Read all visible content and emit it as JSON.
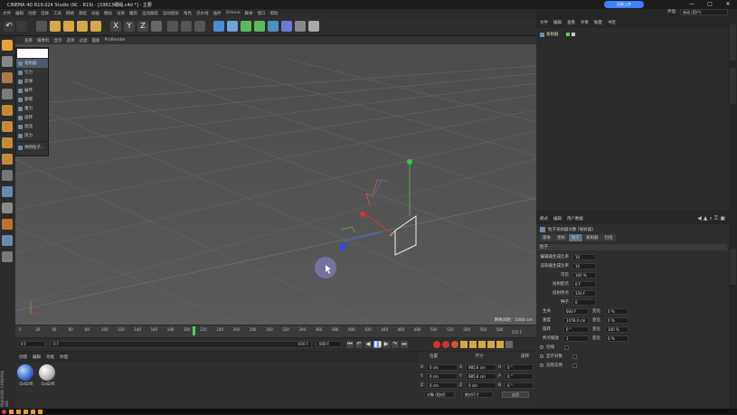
{
  "window": {
    "title": "CINEMA 4D R19.024 Studio (RC - R19) - [19613细绳.c4d *] - 主要",
    "min": "—",
    "max": "□",
    "close": "✕",
    "cloud_label": "回收上传"
  },
  "menubar": [
    "文件",
    "编辑",
    "创建",
    "选择",
    "工具",
    "网格",
    "捕捉",
    "动画",
    "模拟",
    "渲染",
    "雕刻",
    "运动跟踪",
    "运动图形",
    "角色",
    "流水线",
    "插件",
    "Octane",
    "脚本",
    "窗口",
    "帮助"
  ],
  "layout": {
    "label": "界面:",
    "value": "启动 (用户)"
  },
  "viewport": {
    "menu": [
      "查看",
      "摄像机",
      "显示",
      "选项",
      "过滤",
      "面板",
      "ProRender"
    ],
    "grid_distance": "网格间距：1000 cm"
  },
  "dropdown": {
    "items": [
      "发射器",
      "引力",
      "反弹",
      "破坏",
      "摩擦",
      "重力",
      "旋转",
      "湍流",
      "风力",
      "烘焙粒子..."
    ]
  },
  "timeline": {
    "ticks": [
      "0",
      "20",
      "40",
      "60",
      "80",
      "100",
      "120",
      "140",
      "160",
      "180",
      "200",
      "220",
      "240",
      "260",
      "280",
      "300",
      "320",
      "340",
      "360",
      "380",
      "400",
      "420",
      "440",
      "460",
      "480",
      "500",
      "520",
      "540",
      "560",
      "580"
    ],
    "playhead": "215",
    "end_label": "215 F"
  },
  "transport": {
    "start": "0 F",
    "current": "0 F",
    "end_mid": "600 F",
    "end": "600 F"
  },
  "materials": {
    "tabs": [
      "创建",
      "编辑",
      "功能",
      "纹理"
    ],
    "items": [
      "OctDiffi",
      "OctDiffi"
    ]
  },
  "coordinates": {
    "tabs": [
      "位置",
      "尺寸",
      "旋转"
    ],
    "rows": [
      {
        "axis": "X",
        "pos": "0 cm",
        "size": "985.6 cm",
        "rot_label": "H",
        "rot": "0 °"
      },
      {
        "axis": "Y",
        "pos": "0 cm",
        "size": "985.6 cm",
        "rot_label": "P",
        "rot": "0 °"
      },
      {
        "axis": "Z",
        "pos": "0 cm",
        "size": "0 cm",
        "rot_label": "B",
        "rot": "0 °"
      }
    ],
    "mode": "对象 (相对)",
    "size_mode": "绝对尺寸",
    "apply": "应用"
  },
  "objects": {
    "tabs": [
      "文件",
      "编辑",
      "查看",
      "对象",
      "标签",
      "书签"
    ],
    "items": [
      {
        "name": "发射器"
      }
    ]
  },
  "attributes": {
    "tabs": [
      "模式",
      "编辑",
      "用户数据"
    ],
    "object_title": "粒子发射器对象 [发射器]",
    "subtabs": [
      "基本",
      "坐标",
      "粒子",
      "发射器",
      "包括"
    ],
    "section": "粒子",
    "props": [
      {
        "label": "编辑器生成比率",
        "value": "10"
      },
      {
        "label": "渲染器生成比率",
        "value": "10"
      },
      {
        "label": "可见",
        "value": "100 %"
      },
      {
        "label": "投射起点",
        "value": "0 F"
      },
      {
        "label": "投射终点",
        "value": "150 F"
      },
      {
        "label": "种子",
        "value": "0"
      }
    ],
    "props2": [
      {
        "label": "生命",
        "value": "600 F",
        "vlabel": "变化",
        "v": "0 %"
      },
      {
        "label": "速度",
        "value": "1478.4 cm",
        "vlabel": "变化",
        "v": "0 %"
      },
      {
        "label": "旋转",
        "value": "0 °",
        "vlabel": "变化",
        "v": "100 %"
      },
      {
        "label": "终点缩放",
        "value": "1",
        "vlabel": "变化",
        "v": "0 %"
      }
    ],
    "checks": [
      "切线",
      "显示对象",
      "渲染实例"
    ]
  },
  "footer": {
    "brand": "MAXON CINEMA 4D"
  }
}
